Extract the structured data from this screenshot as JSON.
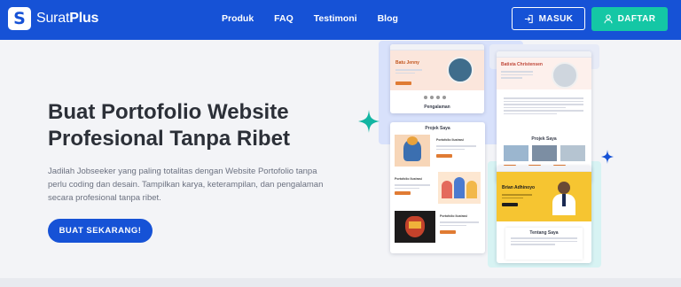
{
  "brand": {
    "name_regular": "Surat",
    "name_bold": "Plus",
    "logo_letter": "S"
  },
  "nav": {
    "items": [
      "Produk",
      "FAQ",
      "Testimoni",
      "Blog"
    ]
  },
  "auth": {
    "login_label": "MASUK",
    "register_label": "DAFTAR"
  },
  "hero": {
    "title_line1": "Buat Portofolio Website",
    "title_line2": "Profesional Tanpa Ribet",
    "description": "Jadilah Jobseeker yang paling totalitas dengan Website Portofolio tanpa perlu coding dan desain. Tampilkan karya, keterampilan, dan pengalaman secara profesional tanpa ribet.",
    "cta_label": "BUAT SEKARANG!"
  },
  "colors": {
    "primary": "#1652d6",
    "accent_green": "#14c7a5",
    "sparkle_teal": "#12b5a2",
    "sparkle_blue": "#1652d6"
  },
  "mockups": {
    "card1": {
      "name": "Batu Jenny",
      "section": "Pengalaman"
    },
    "card2": {
      "name": "Batista Christensen",
      "section": "Projek Saya"
    },
    "card3": {
      "section": "Projek Saya",
      "item1": "Portofolio Ilustrasi",
      "item2": "Portofolio Ilustrasi",
      "item3": "Portofolio Ilustrasi"
    },
    "card4": {
      "name": "Brian Adhinoyo",
      "section": "Tentang Saya"
    }
  }
}
